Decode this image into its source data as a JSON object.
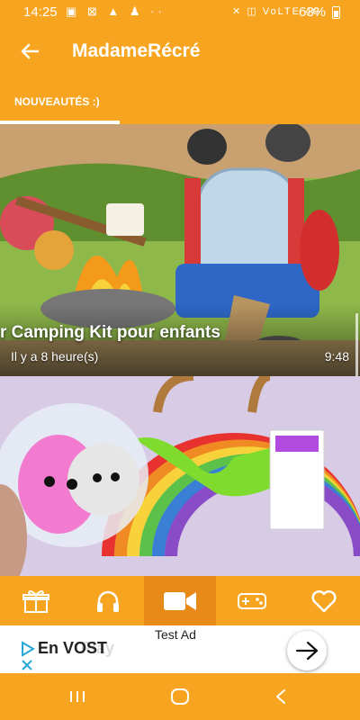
{
  "statusbar": {
    "time": "14:25",
    "left_icons": "▣ ⊠ ▲ ♟ ··",
    "right_icons": "✕ ◫ VoLTE 4G",
    "battery": "63%"
  },
  "appbar": {
    "title": "MadameRécré"
  },
  "tabs": [
    {
      "label": "NOUVEAUTÉS :)"
    }
  ],
  "videos": [
    {
      "title": "r Camping Kit pour enfants",
      "age": "Il y a 8 heure(s)",
      "duration": "9:48"
    },
    {
      "title": "",
      "age": "",
      "duration": ""
    }
  ],
  "bottom_nav": [
    {
      "icon": "gift-icon"
    },
    {
      "icon": "headphones-icon"
    },
    {
      "icon": "video-camera-icon"
    },
    {
      "icon": "gamepad-icon"
    },
    {
      "icon": "heart-icon"
    }
  ],
  "tooltip": "Test Ad",
  "ad": {
    "text": "En VOST",
    "faint_text": "Play",
    "arrow_icon": "arrow-right-icon"
  },
  "colors": {
    "primary": "#f7a521",
    "active_tab": "#e88a17",
    "text_light": "#ffffff"
  }
}
